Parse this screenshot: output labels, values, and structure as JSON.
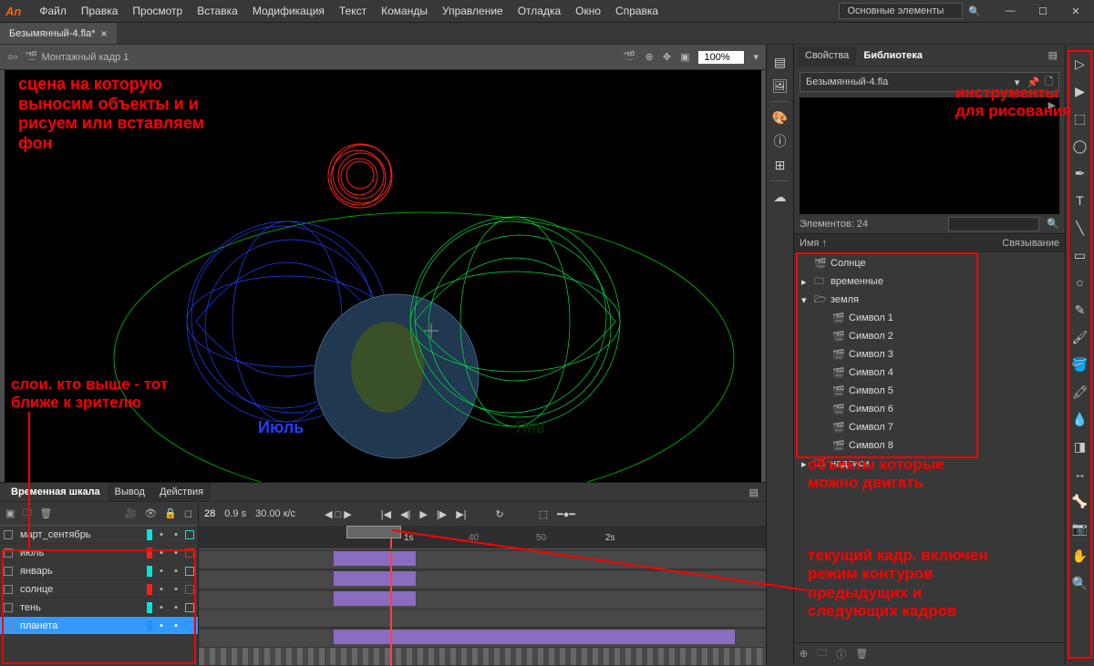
{
  "menubar": {
    "logo": "An",
    "items": [
      "Файл",
      "Правка",
      "Просмотр",
      "Вставка",
      "Модификация",
      "Текст",
      "Команды",
      "Управление",
      "Отладка",
      "Окно",
      "Справка"
    ],
    "workspace": "Основные элементы"
  },
  "doctab": {
    "name": "Безымянный-4.fla*"
  },
  "stage": {
    "scene": "Монтажный кадр 1",
    "zoom": "100%",
    "month_jul": "Июль",
    "month_jan": "Янв"
  },
  "timeline": {
    "tabs": [
      "Временная шкала",
      "Вывод",
      "Действия"
    ],
    "frame": "28",
    "time": "0.9 s",
    "fps": "30.00 к/с",
    "marks": {
      "m1s": "1s",
      "m2s": "2s",
      "m40": "40",
      "m50": "50"
    },
    "layers": [
      {
        "name": "март_сентябрь",
        "color": "#00e5d8",
        "active": false
      },
      {
        "name": "июль",
        "color": "#ff2020",
        "active": false
      },
      {
        "name": "январь",
        "color": "#00e5d8",
        "active": false
      },
      {
        "name": "солнце",
        "color": "#ff2020",
        "active": false
      },
      {
        "name": "тень",
        "color": "#00e5d8",
        "active": false
      },
      {
        "name": "планета",
        "color": "#2090ff",
        "active": true
      }
    ]
  },
  "library": {
    "tabs": [
      "Свойства",
      "Библиотека"
    ],
    "file": "Безымянный-4.fla",
    "count": "Элементов: 24",
    "col_name": "Имя",
    "col_link": "Связывание",
    "items": [
      {
        "level": 0,
        "icon": "clip",
        "label": "Солнце"
      },
      {
        "level": 0,
        "icon": "folder",
        "label": "временные",
        "chev": "▸"
      },
      {
        "level": 0,
        "icon": "folder-open",
        "label": "земля",
        "chev": "▾"
      },
      {
        "level": 1,
        "icon": "clip",
        "label": "Символ 1"
      },
      {
        "level": 1,
        "icon": "clip",
        "label": "Символ 2"
      },
      {
        "level": 1,
        "icon": "clip",
        "label": "Символ 3"
      },
      {
        "level": 1,
        "icon": "clip",
        "label": "Символ 4"
      },
      {
        "level": 1,
        "icon": "clip",
        "label": "Символ 5"
      },
      {
        "level": 1,
        "icon": "clip",
        "label": "Символ 6"
      },
      {
        "level": 1,
        "icon": "clip",
        "label": "Символ 7"
      },
      {
        "level": 1,
        "icon": "clip",
        "label": "Символ 8"
      },
      {
        "level": 0,
        "icon": "folder",
        "label": "надписи",
        "chev": "▸"
      }
    ]
  },
  "annotations": {
    "scene": "сцена на которую\nвыносим объекты и и\nрисуем или вставляем\nфон",
    "layers": "слои. кто выше - тот\nближе к зрителю",
    "tools": "инструменты\nдля рисования",
    "objects": "объекты которые\nможно двигать",
    "frame": "текущий кадр. включен\nрежим контуров\nпредыдущих и\nследующих кадров"
  }
}
